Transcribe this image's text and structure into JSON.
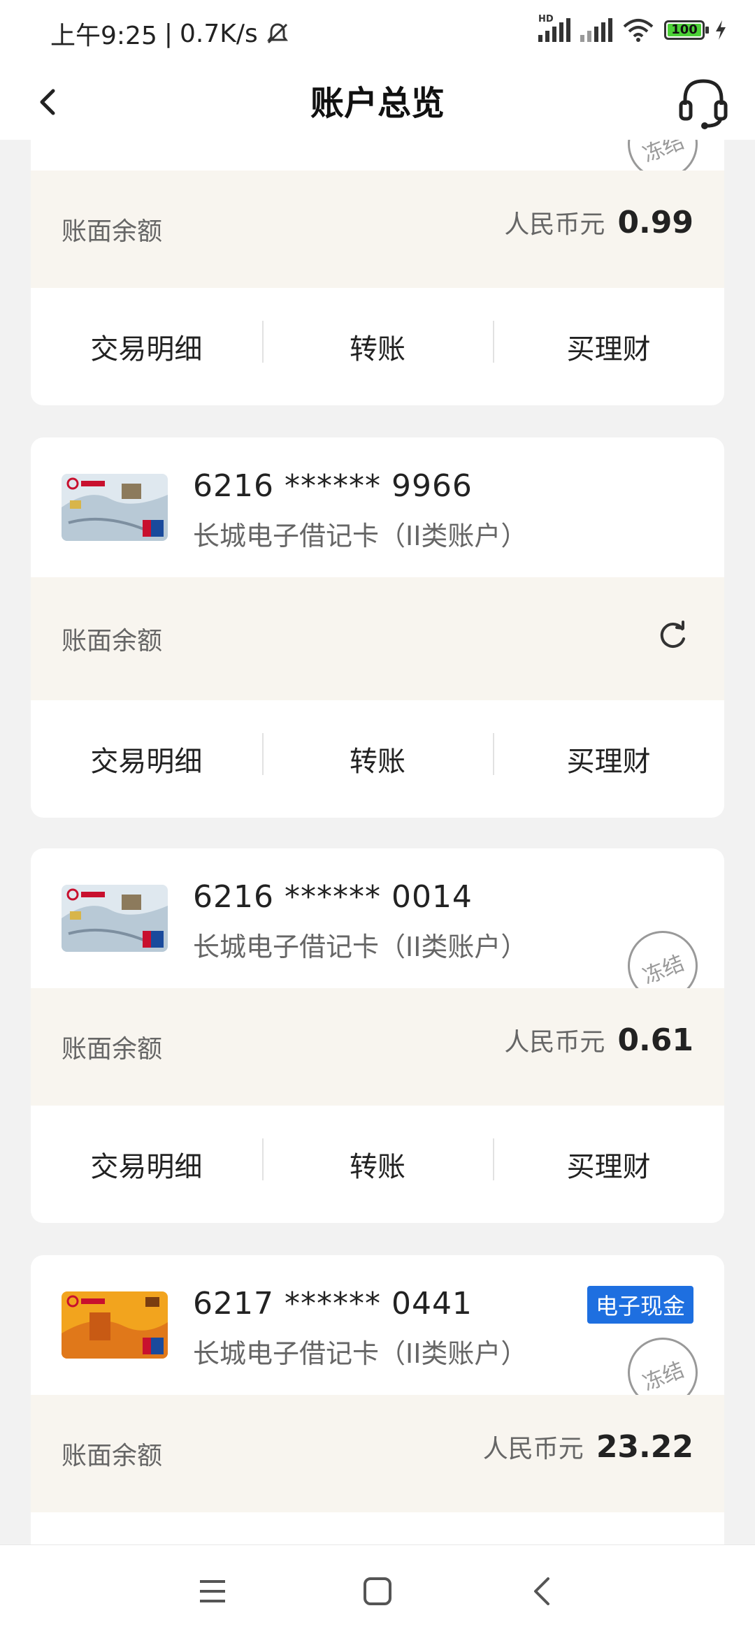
{
  "status": {
    "time": "上午9:25",
    "speed": "0.7K/s",
    "signal_hd": "HD",
    "battery": "100"
  },
  "header": {
    "title": "账户总览"
  },
  "labels": {
    "balance": "账面余额",
    "currency": "人民币元",
    "frozen": "冻结",
    "action_details": "交易明细",
    "action_transfer": "转账",
    "action_wealth": "买理财"
  },
  "accounts": [
    {
      "balance": "0.99",
      "frozen": true
    },
    {
      "number": "6216 ****** 9966",
      "type": "长城电子借记卡（II类账户）",
      "balance_state": "refresh"
    },
    {
      "number": "6216 ****** 0014",
      "type": "长城电子借记卡（II类账户）",
      "balance": "0.61",
      "frozen": true
    },
    {
      "number": "6217 ****** 0441",
      "type": "长城电子借记卡（II类账户）",
      "badge": "电子现金",
      "balance": "23.22",
      "frozen": true
    }
  ],
  "colors": {
    "balance_bg": "#f8f5ef",
    "badge_blue": "#1e6fe0",
    "page_bg": "#f2f2f2"
  },
  "icons": [
    "back-arrow-icon",
    "customer-service-icon",
    "refresh-icon",
    "menu-icon",
    "home-icon",
    "nav-back-icon"
  ]
}
